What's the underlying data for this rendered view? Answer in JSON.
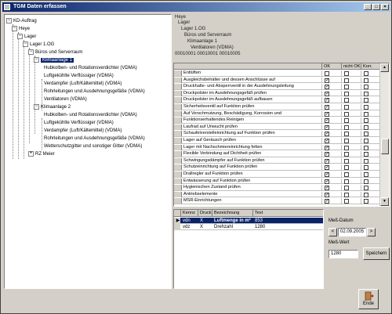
{
  "window": {
    "title": "TGM Daten erfassen",
    "btn_min": "_",
    "btn_max": "□",
    "btn_close": "×"
  },
  "tree": {
    "toggle_minus": "−",
    "toggle_plus": "+",
    "nodes": [
      {
        "label": "KD-Auftrag"
      },
      {
        "label": "Heye"
      },
      {
        "label": "Lager"
      },
      {
        "label": "Lager 1.OG"
      },
      {
        "label": "Büros und Serverraum"
      },
      {
        "label": "Klimaanlage 1"
      },
      {
        "label": "Hubkolben- und Rotationsverdichter (VDMA)"
      },
      {
        "label": "Luftgekühlte Verflüssiger (VDMA)"
      },
      {
        "label": "Verdampfer (Luft/Kältemittel) (VDMA)"
      },
      {
        "label": "Rohrleitungen und Ausdehnungsgefäße (VDMA)"
      },
      {
        "label": "Ventilatoren (VDMA)"
      },
      {
        "label": "Klimaanlage 2"
      },
      {
        "label": "Hubkolben- und Rotationsverdichter (VDMA)"
      },
      {
        "label": "Luftgekühlte Verflüssiger (VDMA)"
      },
      {
        "label": "Verdampfer (Luft/Kältemittel) (VDMA)"
      },
      {
        "label": "Rohrleitungen und Ausdehnungsgefäße (VDMA)"
      },
      {
        "label": "Wetterschutzgitter und sonstiger Gitter (VDMA)"
      },
      {
        "label": "RZ Meier"
      }
    ]
  },
  "info": {
    "line1": "Heye",
    "line2": "Lager",
    "line3": "Lager 1.OG",
    "line4": "Büros und Serverraum",
    "line5": "Klimaanlage 1",
    "line6": "Ventilatoren (VDMA)",
    "line7": "00010001 00010001 00010005"
  },
  "grid": {
    "headers": [
      "OK",
      "nicht OK",
      "Korr."
    ],
    "check_mark": "✓",
    "rows": [
      {
        "text": "Entlüften",
        "ok": false
      },
      {
        "text": "Ausgleichsbehälter und dessen Anschlüsse auf",
        "ok": true
      },
      {
        "text": "Druckhalte- und Absperrventil in der Ausdehnungsleitung",
        "ok": true
      },
      {
        "text": "Druckpolster im Ausdehnungsgefäß prüfen",
        "ok": true
      },
      {
        "text": "Druckpolster im Ausdehnungsgefäß aufbauen",
        "ok": true
      },
      {
        "text": "Sicherheitsventil auf Funktion prüfen",
        "ok": true
      },
      {
        "text": "Auf Verschmutzung, Beschädigung, Korrosion und",
        "ok": true
      },
      {
        "text": "Funktionserhaltendes Reinigen",
        "ok": true
      },
      {
        "text": "Laufrad auf Unwucht prüfen",
        "ok": true
      },
      {
        "text": "Schaufelverstelleinrichtung auf Funktion prüfen",
        "ok": true
      },
      {
        "text": "Lager auf Geräusch prüfen",
        "ok": true
      },
      {
        "text": "Lager mit Nachschmiereinrichtung fetten",
        "ok": true
      },
      {
        "text": "Flexible Verbindung auf Dichtheit prüfen",
        "ok": true
      },
      {
        "text": "Schwingungsdämpfer auf Funktion prüfen",
        "ok": true
      },
      {
        "text": "Schutzeinrichtung auf Funktion prüfen",
        "ok": true
      },
      {
        "text": "Drallregler auf Funktion prüfen",
        "ok": true
      },
      {
        "text": "Entwässerung auf Funktion prüfen",
        "ok": true
      },
      {
        "text": "Hygienischen Zustand prüfen",
        "ok": true
      },
      {
        "text": "Antriebselemente",
        "ok": true
      },
      {
        "text": "MSR-Einrichtungen",
        "ok": true
      }
    ]
  },
  "kennz": {
    "headers": [
      "Kennz",
      "Druck",
      "Bezeichnung",
      "Text"
    ],
    "rows": [
      {
        "kennz": "vdn",
        "druck": "X",
        "bez": "Luftmenge in m³",
        "text": "853"
      },
      {
        "kennz": "vdz",
        "druck": "X",
        "bez": "Drehzahl",
        "text": "1280"
      }
    ]
  },
  "right": {
    "mess_datum_label": "Meß-Datum",
    "date_value": "02.09.2005",
    "prev_arrow": "<",
    "next_arrow": ">",
    "mess_wert_label": "Meß-Wert",
    "wert_value": "1280",
    "speichern": "Speichern",
    "ende": "Ende"
  }
}
